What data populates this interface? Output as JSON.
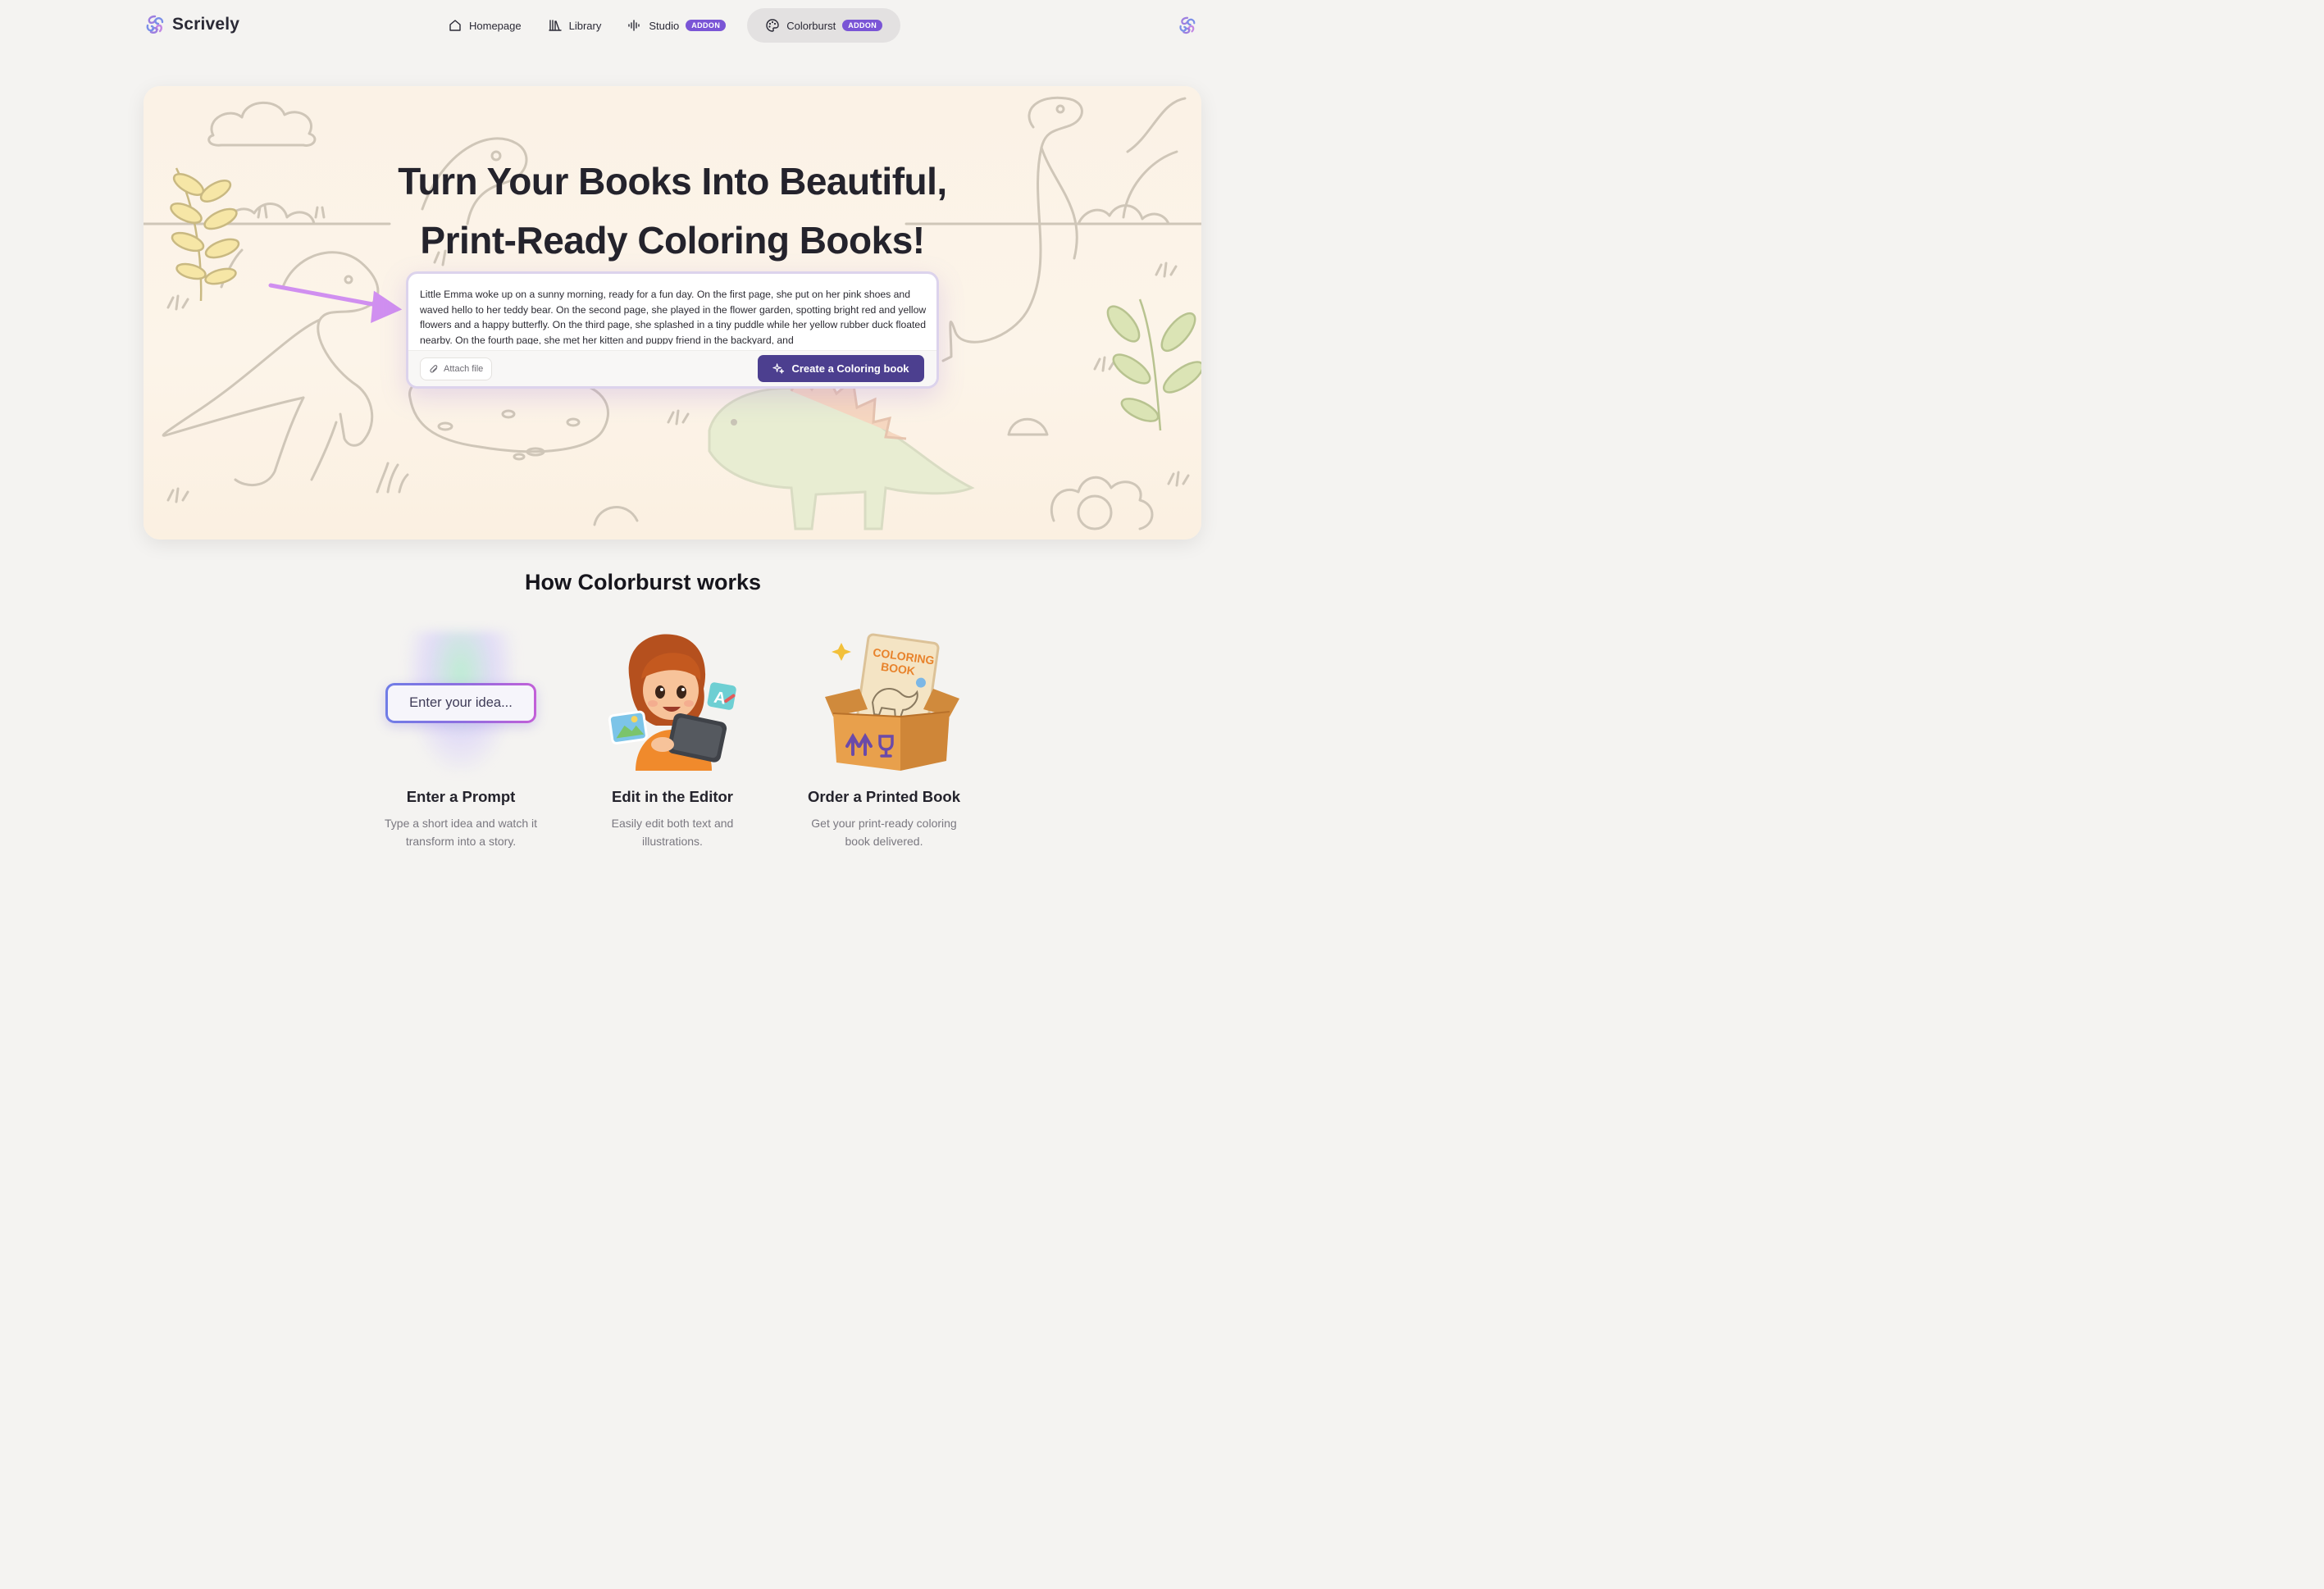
{
  "brand": {
    "name": "Scrively"
  },
  "nav": {
    "items": [
      {
        "label": "Homepage",
        "icon": "home-icon"
      },
      {
        "label": "Library",
        "icon": "library-icon"
      },
      {
        "label": "Studio",
        "icon": "audio-wave-icon",
        "badge": "ADDON"
      },
      {
        "label": "Colorburst",
        "icon": "palette-icon",
        "badge": "ADDON",
        "active": true
      }
    ]
  },
  "hero": {
    "title_line1": "Turn Your Books Into Beautiful,",
    "title_line2": "Print-Ready Coloring Books!",
    "prompt_text": "Little Emma woke up on a sunny morning, ready for a fun day. On the first page, she put on her pink shoes and waved hello to her teddy bear. On the second page, she played in the flower garden, spotting bright red and yellow flowers and a happy butterfly. On the third page, she splashed in a tiny puddle while her yellow rubber duck floated nearby. On the fourth page, she met her kitten and puppy friend in the backyard, and",
    "attach_label": "Attach file",
    "create_label": "Create a Coloring book"
  },
  "how": {
    "title": "How Colorburst works",
    "steps": [
      {
        "title": "Enter a Prompt",
        "desc_line1": "Type a short idea and watch it",
        "desc_line2": "transform into a story.",
        "visual_text": "Enter your idea..."
      },
      {
        "title": "Edit in the Editor",
        "desc_line1": "Easily edit both text and",
        "desc_line2": "illustrations."
      },
      {
        "title": "Order a Printed Book",
        "desc_line1": "Get your print-ready coloring",
        "desc_line2": "book delivered.",
        "box_label_line1": "COLORING",
        "box_label_line2": "BOOK"
      }
    ]
  },
  "colors": {
    "accent": "#4c3f8f",
    "badge": "#7a55d6",
    "hero_bg": "#fbf2e6"
  }
}
